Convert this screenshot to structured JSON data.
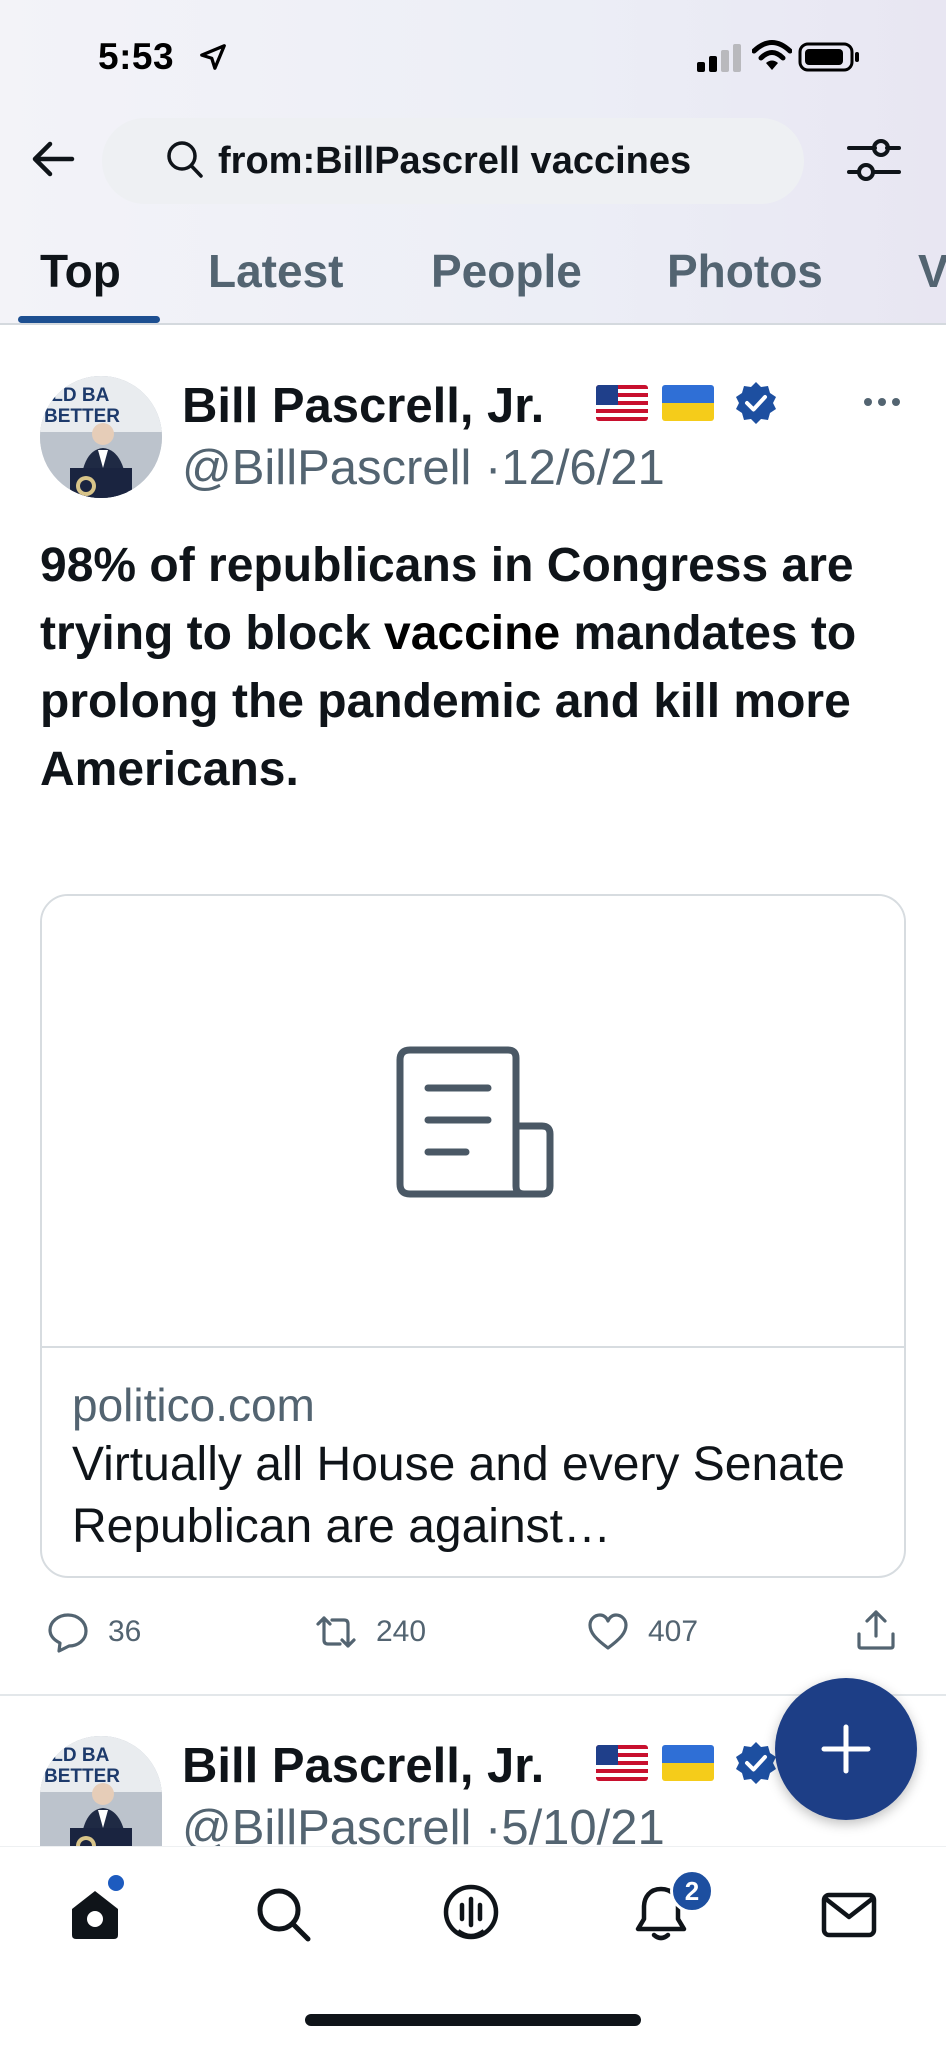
{
  "status_bar": {
    "time": "5:53"
  },
  "search": {
    "query": "from:BillPascrell vaccines"
  },
  "tabs": [
    {
      "label": "Top",
      "active": true
    },
    {
      "label": "Latest",
      "active": false
    },
    {
      "label": "People",
      "active": false
    },
    {
      "label": "Photos",
      "active": false
    },
    {
      "label": "V",
      "active": false
    }
  ],
  "tweets": [
    {
      "display_name": "Bill Pascrell, Jr.",
      "handle": "@BillPascrell",
      "date": "12/6/21",
      "avatar_banner_text": "ILD BA BETTER",
      "text_parts": {
        "line_before": "98% of republicans in Congress are trying to block ",
        "keyword": "vaccine",
        "line_after": " mandates to prolong the pandemic and kill more Americans."
      },
      "card": {
        "domain": "politico.com",
        "title": "Virtually all House and every Senate Republican are against…"
      },
      "stats": {
        "replies": "36",
        "retweets": "240",
        "likes": "407"
      }
    },
    {
      "display_name": "Bill Pascrell, Jr.",
      "handle": "@BillPascrell",
      "date": "5/10/21",
      "avatar_banner_text": "ILD BA BETTER"
    }
  ],
  "bottom_nav": {
    "notification_count": "2"
  },
  "colors": {
    "accent": "#1d4f91",
    "fab": "#1d3e86",
    "verified": "#1d4fa0",
    "secondary_text": "#536471"
  }
}
